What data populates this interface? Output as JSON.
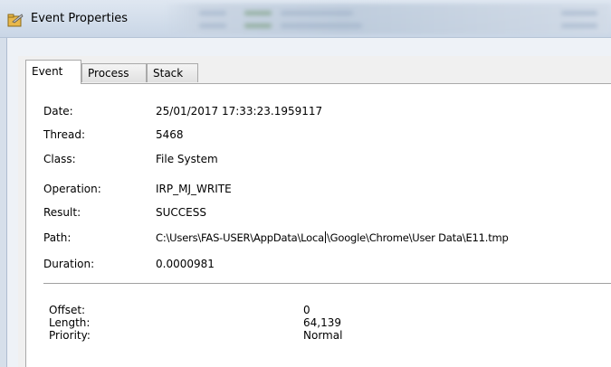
{
  "window": {
    "title": "Event Properties"
  },
  "tabs": [
    {
      "label": "Event",
      "active": true
    },
    {
      "label": "Process",
      "active": false
    },
    {
      "label": "Stack",
      "active": false
    }
  ],
  "event": {
    "date_label": "Date:",
    "date_value": "25/01/2017 17:33:23.1959117",
    "thread_label": "Thread:",
    "thread_value": "5468",
    "class_label": "Class:",
    "class_value": "File System",
    "operation_label": "Operation:",
    "operation_value": "IRP_MJ_WRITE",
    "result_label": "Result:",
    "result_value": "SUCCESS",
    "path_label": "Path:",
    "path_value_part1": "C:\\Users\\FAS-USER\\AppData\\Loca",
    "path_value_part2": "\\Google\\Chrome\\User Data\\E11.tmp",
    "duration_label": "Duration:",
    "duration_value": "0.0000981"
  },
  "details": {
    "offset_label": "Offset:",
    "offset_value": "0",
    "length_label": "Length:",
    "length_value": "64,139",
    "priority_label": "Priority:",
    "priority_value": "Normal"
  },
  "colors": {
    "titlebar_top": "#dfe7f1",
    "titlebar_bottom": "#c9d6e6",
    "panel_bg": "#f0f0f0",
    "content_bg": "#ffffff"
  }
}
